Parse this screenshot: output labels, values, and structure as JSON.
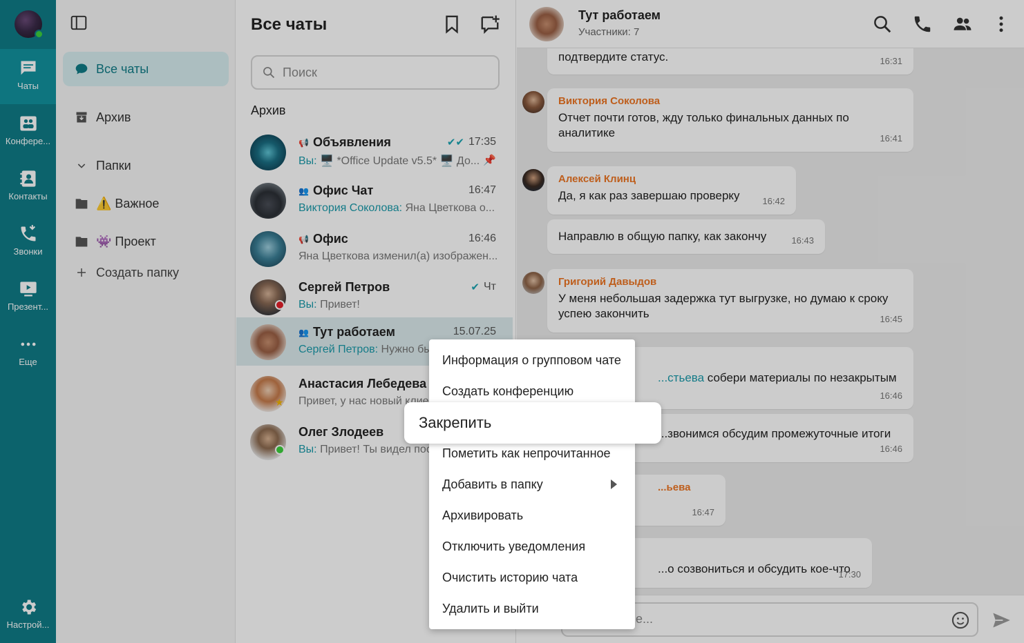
{
  "rail": {
    "items": [
      {
        "label": "Чаты",
        "icon": "chat-icon"
      },
      {
        "label": "Конфере...",
        "icon": "conference-icon"
      },
      {
        "label": "Контакты",
        "icon": "contacts-icon"
      },
      {
        "label": "Звонки",
        "icon": "calls-icon"
      },
      {
        "label": "Презент...",
        "icon": "presentation-icon"
      },
      {
        "label": "Еще",
        "icon": "more-dots-icon"
      },
      {
        "label": "Настрой...",
        "icon": "settings-gear-icon"
      }
    ]
  },
  "folders": {
    "all_chats": "Все чаты",
    "archive": "Архив",
    "folders_header": "Папки",
    "folder_important": "⚠️ Важное",
    "folder_project": "👾 Проект",
    "create_folder": "Создать папку"
  },
  "list": {
    "title": "Все чаты",
    "search_placeholder": "Поиск",
    "section_archive": "Архив",
    "chats": [
      {
        "name": "Объявления",
        "time": "17:35",
        "sender": "Вы:",
        "preview": " 🖥️ *Office Update v5.5* 🖥️ До...",
        "read": true,
        "pinned": true,
        "kind": "channel"
      },
      {
        "name": "Офис Чат",
        "time": "16:47",
        "sender": "Виктория Соколова:",
        "preview": " Яна Цветкова о...",
        "kind": "group"
      },
      {
        "name": "Офис",
        "time": "16:46",
        "sender": "",
        "preview": "Яна Цветкова изменил(а) изображен...",
        "kind": "channel"
      },
      {
        "name": "Сергей Петров",
        "time": "Чт",
        "sender": "Вы:",
        "preview": " Привет!",
        "read": true,
        "kind": "person",
        "status": "busy"
      },
      {
        "name": "Тут работаем",
        "time": "15.07.25",
        "sender": "Сергей Петров:",
        "preview": " Нужно бы...",
        "kind": "group",
        "selected": true
      },
      {
        "name": "Анастасия Лебедева",
        "time": "",
        "sender": "",
        "preview": "Привет, у нас новый клиент",
        "kind": "person"
      },
      {
        "name": "Олег Злодеев",
        "time": "",
        "sender": "Вы:",
        "preview": " Привет! Ты видел пос",
        "kind": "person",
        "status": "online"
      }
    ]
  },
  "conversation": {
    "title": "Тут работаем",
    "subtitle": "Участники: 7",
    "messages": [
      {
        "text": "подтвердите статус.",
        "time": "16:31"
      },
      {
        "author": "Виктория Соколова",
        "text": "Отчет почти готов, жду только финальных данных по аналитике",
        "time": "16:41"
      },
      {
        "author": "Алексей Клинц",
        "text": "Да, я как раз завершаю проверку",
        "time": "16:42"
      },
      {
        "text": "Направлю в общую папку, как закончу",
        "time": "16:43"
      },
      {
        "author": "Григорий Давыдов",
        "text": "У меня небольшая задержка тут выгрузке, но думаю к сроку успею закончить",
        "time": "16:45"
      },
      {
        "mention": "...стьева",
        "text": " собери материалы по незакрытым",
        "time": "16:46"
      },
      {
        "text": "...звонимся обсудим промежуточные итоги",
        "time": "16:46"
      },
      {
        "author": "...ьева",
        "text": "",
        "time": "16:47"
      },
      {
        "text": "...о созвониться и обсудить кое-что",
        "time": "17:30"
      }
    ],
    "composer_placeholder": "Сообщение..."
  },
  "context_menu": {
    "items": [
      "Информация о групповом чате",
      "Создать конференцию",
      "Закрепить",
      "Пометить как непрочитанное",
      "Добавить в папку",
      "Архивировать",
      "Отключить уведомления",
      "Очистить историю чата",
      "Удалить и выйти"
    ],
    "highlighted": "Закрепить"
  },
  "colors": {
    "rail": "#0f7c87",
    "accent": "#1a9aaa",
    "author": "#ee7623",
    "online": "#3ed13e",
    "busy": "#e5202a"
  }
}
